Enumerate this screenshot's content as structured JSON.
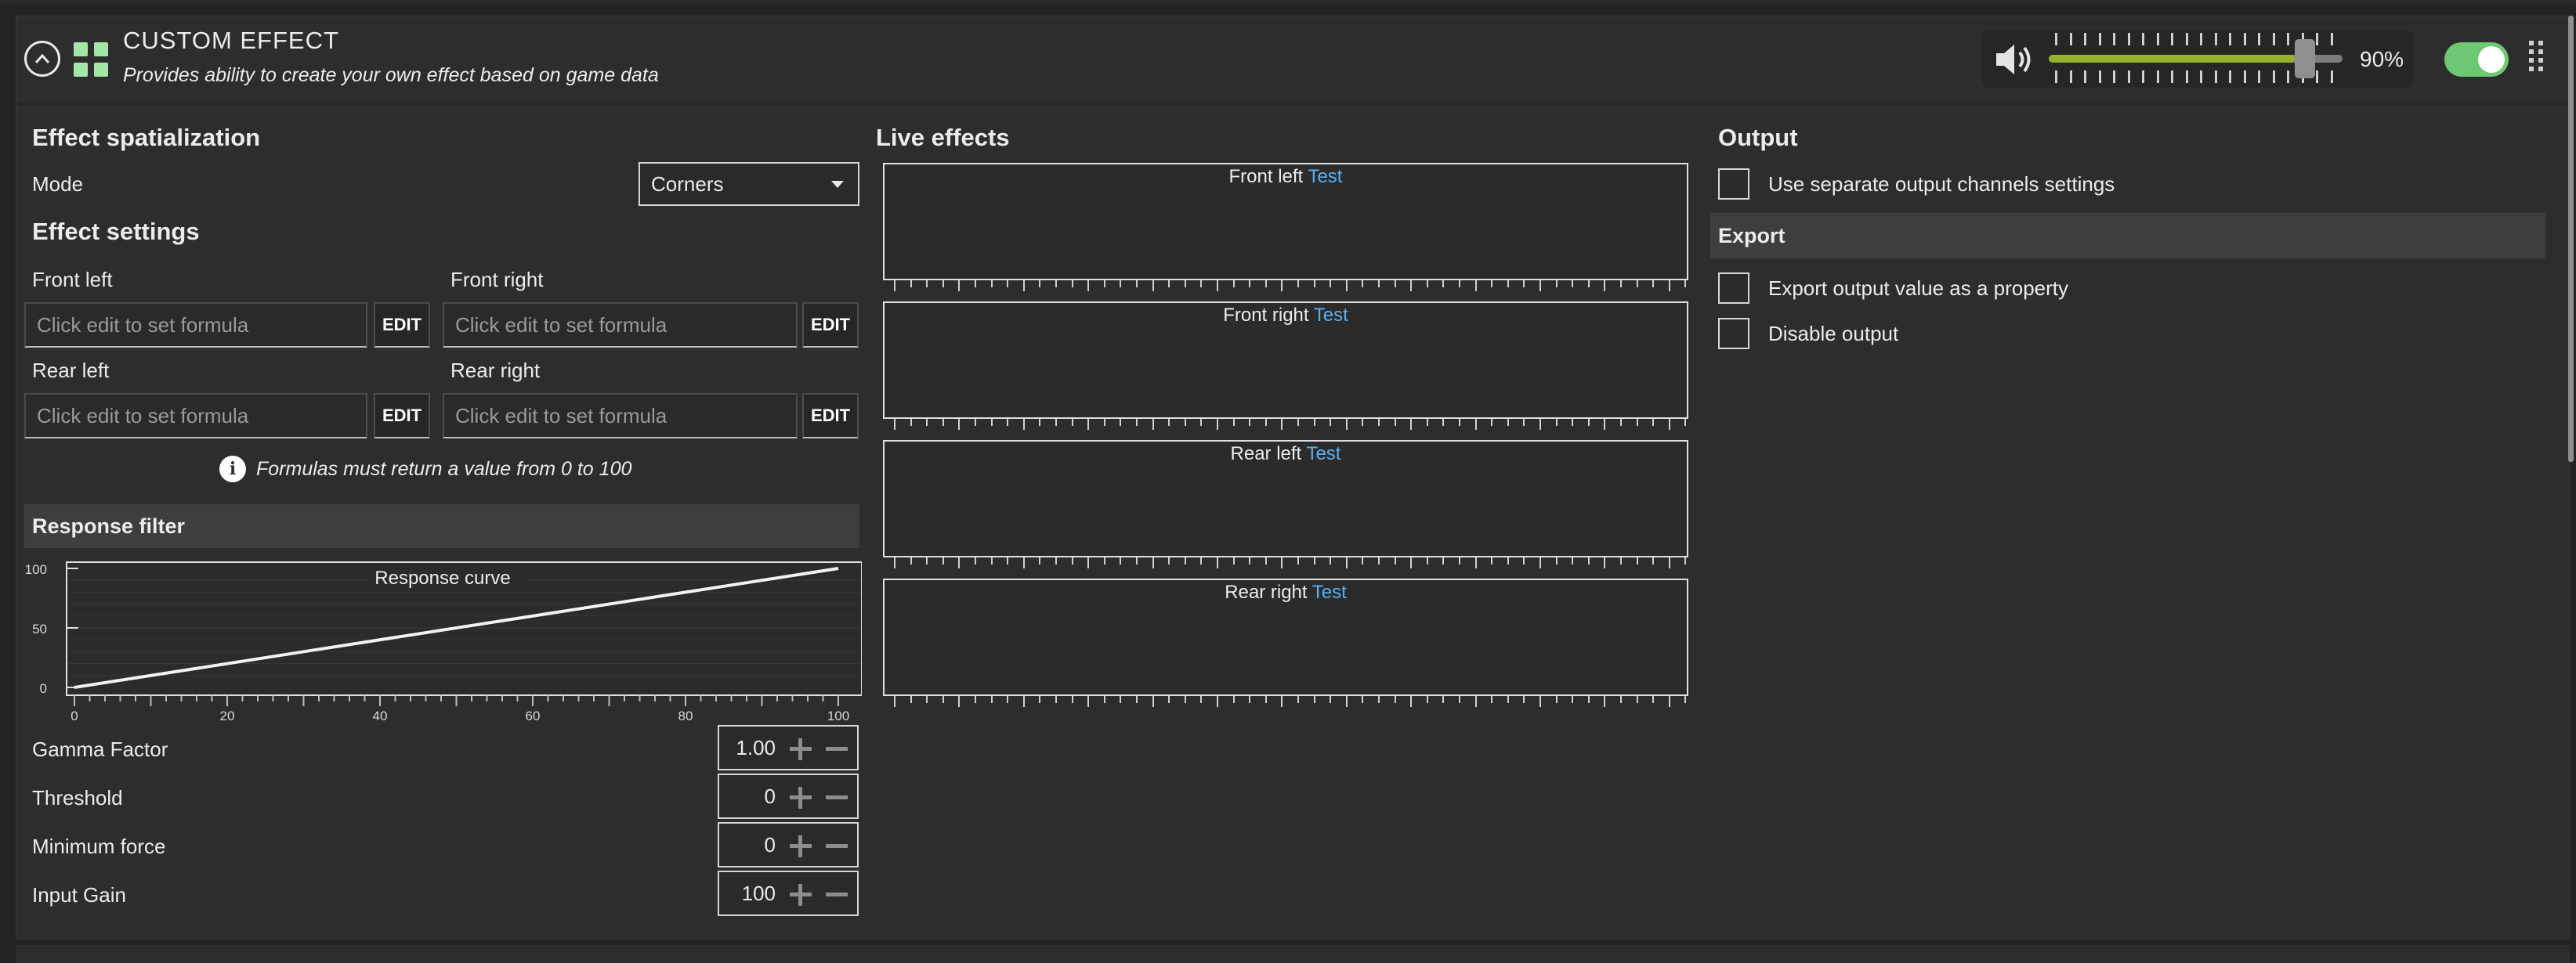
{
  "header": {
    "title": "CUSTOM EFFECT",
    "description": "Provides ability to create your own effect based on game data",
    "volume_percent": 90,
    "volume_label": "90%",
    "enabled": true
  },
  "left": {
    "spatialization_title": "Effect spatialization",
    "mode_label": "Mode",
    "mode_value": "Corners",
    "settings_title": "Effect settings",
    "formulas": [
      {
        "label": "Front left",
        "placeholder": "Click edit to set formula",
        "button": "EDIT"
      },
      {
        "label": "Front right",
        "placeholder": "Click edit to set formula",
        "button": "EDIT"
      },
      {
        "label": "Rear left",
        "placeholder": "Click edit to set formula",
        "button": "EDIT"
      },
      {
        "label": "Rear right",
        "placeholder": "Click edit to set formula",
        "button": "EDIT"
      }
    ],
    "formula_note": "Formulas must return a value from 0 to 100",
    "response_filter_title": "Response filter",
    "curve_title": "Response curve",
    "curve_y_ticks": [
      "100",
      "50",
      "0"
    ],
    "curve_x_ticks": [
      "0",
      "20",
      "40",
      "60",
      "80",
      "100"
    ],
    "params": [
      {
        "label": "Gamma Factor",
        "value": "1.00"
      },
      {
        "label": "Threshold",
        "value": "0"
      },
      {
        "label": "Minimum force",
        "value": "0"
      },
      {
        "label": "Input Gain",
        "value": "100"
      }
    ]
  },
  "live": {
    "title": "Live effects",
    "channels": [
      {
        "name": "Front left",
        "test": "Test"
      },
      {
        "name": "Front right",
        "test": "Test"
      },
      {
        "name": "Rear left",
        "test": "Test"
      },
      {
        "name": "Rear right",
        "test": "Test"
      }
    ]
  },
  "output": {
    "title": "Output",
    "separate_channels_label": "Use separate output channels settings",
    "export_title": "Export",
    "export_property_label": "Export output value as a property",
    "disable_output_label": "Disable output"
  },
  "colors": {
    "accent_green": "#97b12b",
    "toggle_green": "#6ec773",
    "link_blue": "#5ab0f0",
    "icon_green": "#a3e6a8"
  },
  "icons": [
    "chevron-up-icon",
    "grid-icon",
    "speaker-icon",
    "info-icon",
    "plus-icon",
    "minus-icon",
    "drag-handle-icon"
  ]
}
